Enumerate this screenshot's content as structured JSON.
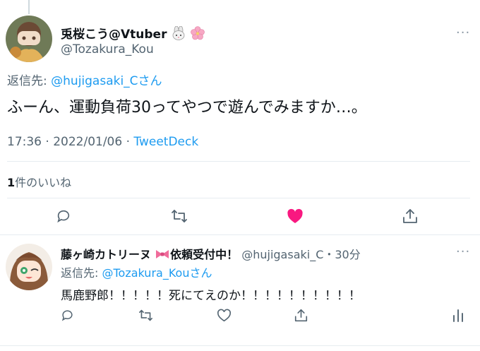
{
  "main_tweet": {
    "display_name": "兎桜こう@Vtuber",
    "handle": "@Tozakura_Kou",
    "reply_prefix": "返信先: ",
    "reply_to": "@hujigasaki_Cさん",
    "text": "ふーん、運動負荷30ってやつで遊んでみますか…。",
    "time": "17:36 · 2022/01/06 · ",
    "client": "TweetDeck",
    "likes_count": "1",
    "likes_label": "件のいいね",
    "liked": true,
    "like_color": "#f91880"
  },
  "reply_tweet": {
    "display_name": "藤ヶ崎カトリーヌ",
    "name_suffix": "依頼受付中！",
    "handle_time": "@hujigasaki_C・30分",
    "reply_prefix": "返信先: ",
    "reply_to": "@Tozakura_Kouさん",
    "text": "馬鹿野郎！！！！！死にてえのか！！！！！！！！！！"
  },
  "more_icon": "···",
  "colors": {
    "link": "#1d9bf0",
    "muted": "#536471",
    "divider": "#e6ecf0"
  }
}
